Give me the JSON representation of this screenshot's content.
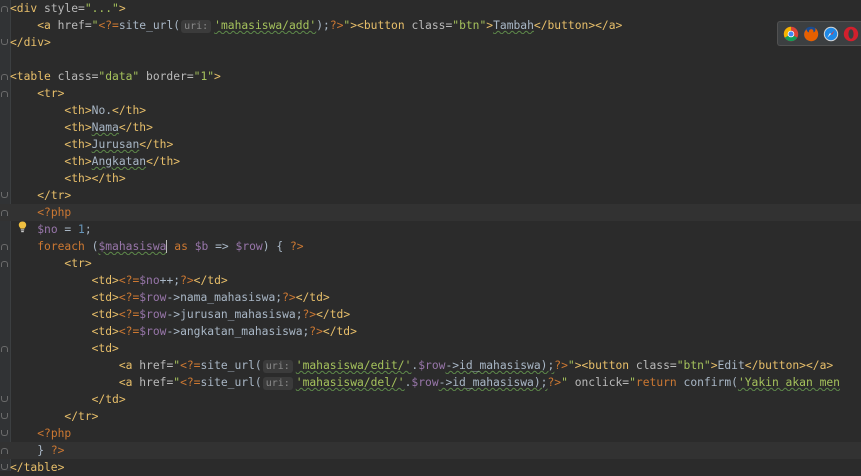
{
  "editor": {
    "lines": [
      {
        "tokens": [
          {
            "c": "tag",
            "t": "<div "
          },
          {
            "c": "attr",
            "t": "style="
          },
          {
            "c": "str",
            "t": "\"...\""
          },
          {
            "c": "tag",
            "t": ">"
          }
        ]
      },
      {
        "tokens": [
          {
            "c": "txt",
            "t": "    "
          },
          {
            "c": "tag",
            "t": "<a "
          },
          {
            "c": "attr",
            "t": "href="
          },
          {
            "c": "str",
            "t": "\""
          },
          {
            "c": "php",
            "t": "<?="
          },
          {
            "c": "fn",
            "t": "site_url("
          },
          {
            "c": "hint",
            "t": "uri:"
          },
          {
            "c": "str",
            "t": "'mahasiswa/add'"
          },
          {
            "c": "fn",
            "t": ");"
          },
          {
            "c": "php",
            "t": "?>"
          },
          {
            "c": "str",
            "t": "\""
          },
          {
            "c": "tag",
            "t": "><button "
          },
          {
            "c": "attr",
            "t": "class="
          },
          {
            "c": "str",
            "t": "\"btn\""
          },
          {
            "c": "tag",
            "t": ">"
          },
          {
            "c": "txt",
            "t": "Tambah"
          },
          {
            "c": "tag",
            "t": "</button></a>"
          }
        ]
      },
      {
        "tokens": [
          {
            "c": "tag",
            "t": "</div>"
          }
        ]
      },
      {
        "tokens": []
      },
      {
        "tokens": [
          {
            "c": "tag",
            "t": "<table "
          },
          {
            "c": "attr",
            "t": "class="
          },
          {
            "c": "str",
            "t": "\"data\" "
          },
          {
            "c": "attr",
            "t": "border="
          },
          {
            "c": "str",
            "t": "\"1\""
          },
          {
            "c": "tag",
            "t": ">"
          }
        ]
      },
      {
        "tokens": [
          {
            "c": "txt",
            "t": "    "
          },
          {
            "c": "tag",
            "t": "<tr>"
          }
        ]
      },
      {
        "tokens": [
          {
            "c": "txt",
            "t": "        "
          },
          {
            "c": "tag",
            "t": "<th>"
          },
          {
            "c": "txt",
            "t": "No."
          },
          {
            "c": "tag",
            "t": "</th>"
          }
        ]
      },
      {
        "tokens": [
          {
            "c": "txt",
            "t": "        "
          },
          {
            "c": "tag",
            "t": "<th>"
          },
          {
            "c": "txt",
            "t": "Nama"
          },
          {
            "c": "tag",
            "t": "</th>"
          }
        ]
      },
      {
        "tokens": [
          {
            "c": "txt",
            "t": "        "
          },
          {
            "c": "tag",
            "t": "<th>"
          },
          {
            "c": "txt",
            "t": "Jurusan"
          },
          {
            "c": "tag",
            "t": "</th>"
          }
        ]
      },
      {
        "tokens": [
          {
            "c": "txt",
            "t": "        "
          },
          {
            "c": "tag",
            "t": "<th>"
          },
          {
            "c": "txt",
            "t": "Angkatan"
          },
          {
            "c": "tag",
            "t": "</th>"
          }
        ]
      },
      {
        "tokens": [
          {
            "c": "txt",
            "t": "        "
          },
          {
            "c": "tag",
            "t": "<th></th>"
          }
        ]
      },
      {
        "tokens": [
          {
            "c": "txt",
            "t": "    "
          },
          {
            "c": "tag",
            "t": "</tr>"
          }
        ]
      },
      {
        "tokens": [
          {
            "c": "txt",
            "t": "    "
          },
          {
            "c": "php",
            "t": "<?php"
          }
        ]
      },
      {
        "tokens": [
          {
            "c": "txt",
            "t": "    "
          },
          {
            "c": "var",
            "t": "$no"
          },
          {
            "c": "txt",
            "t": " = "
          },
          {
            "c": "num",
            "t": "1"
          },
          {
            "c": "txt",
            "t": ";"
          }
        ]
      },
      {
        "tokens": [
          {
            "c": "txt",
            "t": "    "
          },
          {
            "c": "kw",
            "t": "foreach"
          },
          {
            "c": "txt",
            "t": " ("
          },
          {
            "c": "var",
            "t": "$mahasiswa"
          },
          {
            "c": "caret",
            "t": ""
          },
          {
            "c": "txt",
            "t": " "
          },
          {
            "c": "kw",
            "t": "as"
          },
          {
            "c": "txt",
            "t": " "
          },
          {
            "c": "var",
            "t": "$b"
          },
          {
            "c": "txt",
            "t": " => "
          },
          {
            "c": "var",
            "t": "$row"
          },
          {
            "c": "txt",
            "t": ") { "
          },
          {
            "c": "php",
            "t": "?>"
          }
        ]
      },
      {
        "tokens": [
          {
            "c": "txt",
            "t": "        "
          },
          {
            "c": "tag",
            "t": "<tr>"
          }
        ]
      },
      {
        "tokens": [
          {
            "c": "txt",
            "t": "            "
          },
          {
            "c": "tag",
            "t": "<td>"
          },
          {
            "c": "php",
            "t": "<?="
          },
          {
            "c": "var",
            "t": "$no"
          },
          {
            "c": "txt",
            "t": "++;"
          },
          {
            "c": "php",
            "t": "?>"
          },
          {
            "c": "tag",
            "t": "</td>"
          }
        ]
      },
      {
        "tokens": [
          {
            "c": "txt",
            "t": "            "
          },
          {
            "c": "tag",
            "t": "<td>"
          },
          {
            "c": "php",
            "t": "<?="
          },
          {
            "c": "var",
            "t": "$row"
          },
          {
            "c": "txt",
            "t": "->nama_mahasiswa;"
          },
          {
            "c": "php",
            "t": "?>"
          },
          {
            "c": "tag",
            "t": "</td>"
          }
        ]
      },
      {
        "tokens": [
          {
            "c": "txt",
            "t": "            "
          },
          {
            "c": "tag",
            "t": "<td>"
          },
          {
            "c": "php",
            "t": "<?="
          },
          {
            "c": "var",
            "t": "$row"
          },
          {
            "c": "txt",
            "t": "->jurusan_mahasiswa;"
          },
          {
            "c": "php",
            "t": "?>"
          },
          {
            "c": "tag",
            "t": "</td>"
          }
        ]
      },
      {
        "tokens": [
          {
            "c": "txt",
            "t": "            "
          },
          {
            "c": "tag",
            "t": "<td>"
          },
          {
            "c": "php",
            "t": "<?="
          },
          {
            "c": "var",
            "t": "$row"
          },
          {
            "c": "txt",
            "t": "->angkatan_mahasiswa;"
          },
          {
            "c": "php",
            "t": "?>"
          },
          {
            "c": "tag",
            "t": "</td>"
          }
        ]
      },
      {
        "tokens": [
          {
            "c": "txt",
            "t": "            "
          },
          {
            "c": "tag",
            "t": "<td>"
          }
        ]
      },
      {
        "tokens": [
          {
            "c": "txt",
            "t": "                "
          },
          {
            "c": "tag",
            "t": "<a "
          },
          {
            "c": "attr",
            "t": "href="
          },
          {
            "c": "str",
            "t": "\""
          },
          {
            "c": "php",
            "t": "<?="
          },
          {
            "c": "fn",
            "t": "site_url("
          },
          {
            "c": "hint",
            "t": "uri:"
          },
          {
            "c": "str",
            "t": "'mahasiswa/edit/'"
          },
          {
            "c": "txt",
            "t": "."
          },
          {
            "c": "var",
            "t": "$row"
          },
          {
            "c": "txt",
            "t": "->id_mahasiswa);"
          },
          {
            "c": "php",
            "t": "?>"
          },
          {
            "c": "str",
            "t": "\""
          },
          {
            "c": "tag",
            "t": "><button "
          },
          {
            "c": "attr",
            "t": "class="
          },
          {
            "c": "str",
            "t": "\"btn\""
          },
          {
            "c": "tag",
            "t": ">"
          },
          {
            "c": "txt",
            "t": "Edit"
          },
          {
            "c": "tag",
            "t": "</button></a>"
          }
        ]
      },
      {
        "tokens": [
          {
            "c": "txt",
            "t": "                "
          },
          {
            "c": "tag",
            "t": "<a "
          },
          {
            "c": "attr",
            "t": "href="
          },
          {
            "c": "str",
            "t": "\""
          },
          {
            "c": "php",
            "t": "<?="
          },
          {
            "c": "fn",
            "t": "site_url("
          },
          {
            "c": "hint",
            "t": "uri:"
          },
          {
            "c": "str",
            "t": "'mahasiswa/del/'"
          },
          {
            "c": "txt",
            "t": "."
          },
          {
            "c": "var",
            "t": "$row"
          },
          {
            "c": "txt",
            "t": "->id_mahasiswa);"
          },
          {
            "c": "php",
            "t": "?>"
          },
          {
            "c": "str",
            "t": "\" "
          },
          {
            "c": "attr",
            "t": "onclick="
          },
          {
            "c": "str",
            "t": "\""
          },
          {
            "c": "kw",
            "t": "return "
          },
          {
            "c": "fn",
            "t": "confirm("
          },
          {
            "c": "str",
            "t": "'Yakin akan men"
          }
        ]
      },
      {
        "tokens": [
          {
            "c": "txt",
            "t": "            "
          },
          {
            "c": "tag",
            "t": "</td>"
          }
        ]
      },
      {
        "tokens": [
          {
            "c": "txt",
            "t": "        "
          },
          {
            "c": "tag",
            "t": "</tr>"
          }
        ]
      },
      {
        "tokens": [
          {
            "c": "txt",
            "t": "    "
          },
          {
            "c": "php",
            "t": "<?php"
          }
        ]
      },
      {
        "tokens": [
          {
            "c": "txt",
            "t": "    } "
          },
          {
            "c": "php",
            "t": "?>"
          }
        ]
      },
      {
        "tokens": [
          {
            "c": "tag",
            "t": "</table>"
          }
        ]
      }
    ]
  },
  "browsers": [
    {
      "name": "chrome-icon",
      "color": "#4a8af4"
    },
    {
      "name": "firefox-icon",
      "color": "#e66000"
    },
    {
      "name": "safari-icon",
      "color": "#1e88e5"
    },
    {
      "name": "opera-icon",
      "color": "#d3202d"
    }
  ]
}
